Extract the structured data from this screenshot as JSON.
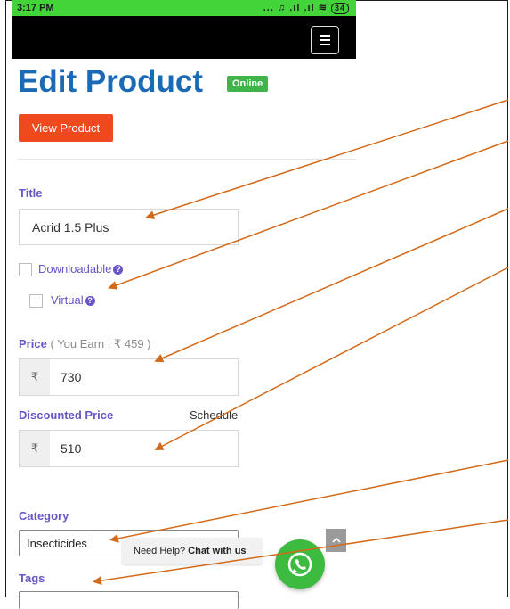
{
  "statusbar": {
    "time": "3:17 PM",
    "icons": "... ♫ .ıl .ıl ≋",
    "battery": "34"
  },
  "page": {
    "title": "Edit Product",
    "status_badge": "Online",
    "view_button": "View Product"
  },
  "form": {
    "title_label": "Title",
    "title_value": "Acrid 1.5 Plus",
    "downloadable_label": "Downloadable",
    "virtual_label": "Virtual",
    "help_glyph": "?",
    "price_label": "Price",
    "price_earn_note": "( You Earn : ₹ 459 )",
    "currency_symbol": "₹",
    "price_value": "730",
    "discount_label": "Discounted Price",
    "schedule_label": "Schedule",
    "discount_value": "510",
    "category_label": "Category",
    "category_value": "Insecticides",
    "tags_label": "Tags"
  },
  "chat_widget": {
    "prefix": "Need Help?",
    "link": "Chat with us"
  },
  "icons": {
    "menu": "hamburger-icon",
    "help": "question-circle-icon",
    "whatsapp": "whatsapp-icon",
    "scroll_top": "chevron-up-icon"
  },
  "colors": {
    "status_bar": "#43d43a",
    "title": "#1a6ab5",
    "badge": "#3fb44a",
    "primary_button": "#ee4a1e",
    "label": "#6a55c6",
    "annotation_arrow": "#d36a1a",
    "whatsapp": "#3dbb41"
  }
}
